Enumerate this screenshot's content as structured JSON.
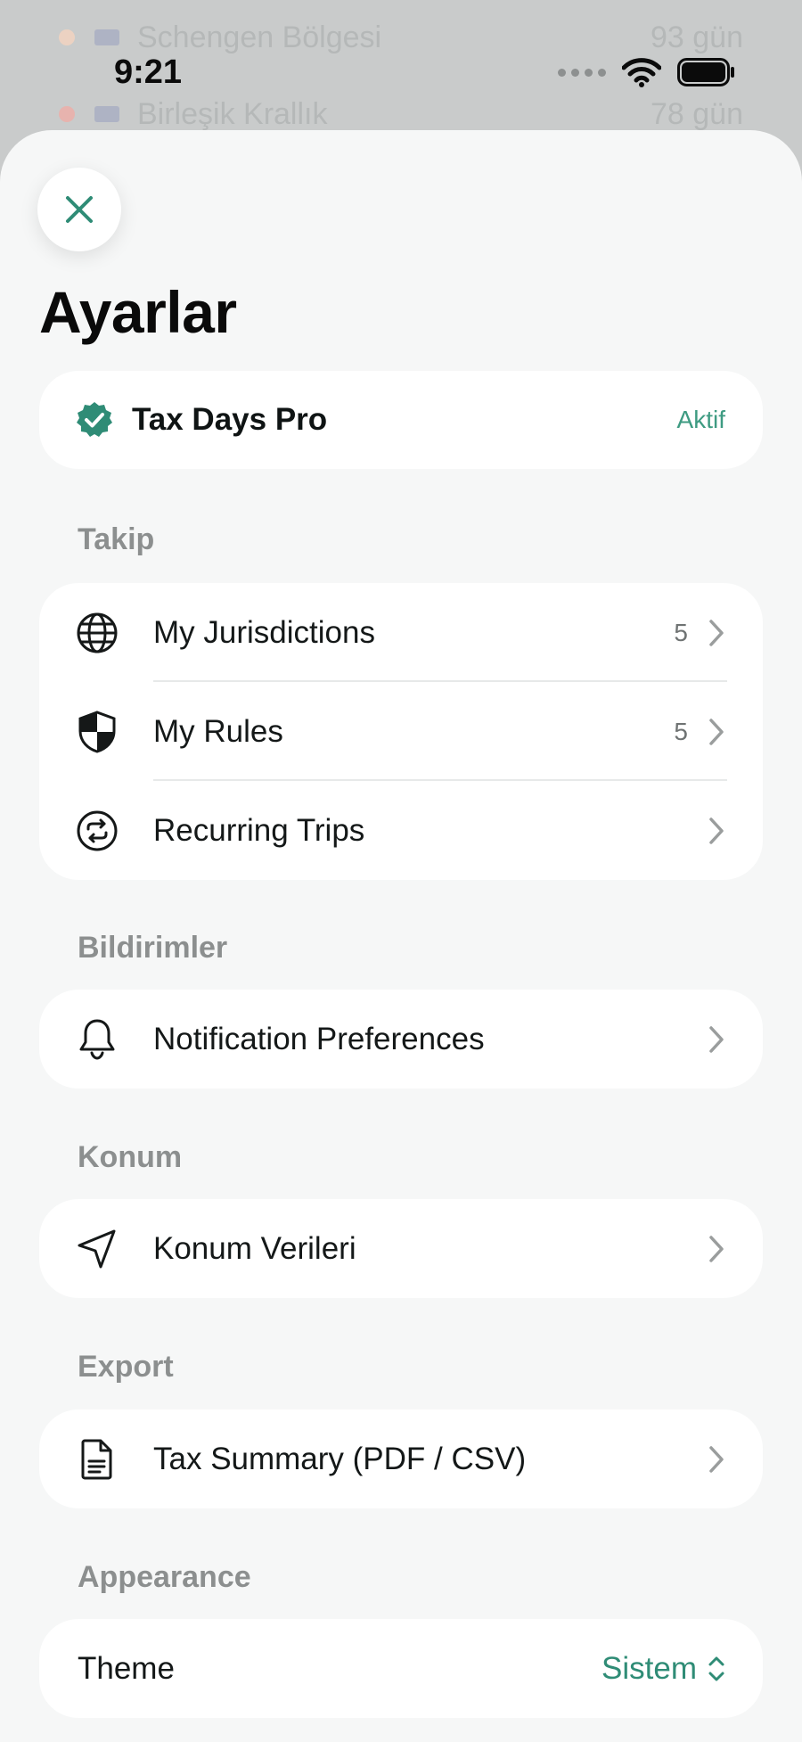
{
  "background": {
    "rows": [
      {
        "name": "Schengen Bölgesi",
        "value": "93 gün",
        "dot_color": "#e7c7b5"
      },
      {
        "name": "Birleşik Krallık",
        "value": "78 gün",
        "dot_color": "#e4a9a4"
      }
    ]
  },
  "status_bar": {
    "time": "9:21"
  },
  "sheet": {
    "title": "Ayarlar",
    "pro": {
      "title": "Tax Days Pro",
      "status": "Aktif"
    },
    "sections": {
      "tracking": {
        "label": "Takip",
        "items": [
          {
            "label": "My Jurisdictions",
            "count": "5",
            "icon": "globe-icon"
          },
          {
            "label": "My Rules",
            "count": "5",
            "icon": "shield-icon"
          },
          {
            "label": "Recurring Trips",
            "count": "",
            "icon": "repeat-icon"
          }
        ]
      },
      "notifications": {
        "label": "Bildirimler",
        "items": [
          {
            "label": "Notification Preferences",
            "icon": "bell-icon"
          }
        ]
      },
      "location": {
        "label": "Konum",
        "items": [
          {
            "label": "Konum Verileri",
            "icon": "location-arrow-icon"
          }
        ]
      },
      "export": {
        "label": "Export",
        "items": [
          {
            "label": "Tax Summary (PDF / CSV)",
            "icon": "document-icon"
          }
        ]
      },
      "appearance": {
        "label": "Appearance",
        "theme_label": "Theme",
        "theme_value": "Sistem"
      }
    }
  },
  "colors": {
    "accent": "#2f8c76",
    "sheet_background": "#f6f7f7",
    "card": "#ffffff"
  }
}
